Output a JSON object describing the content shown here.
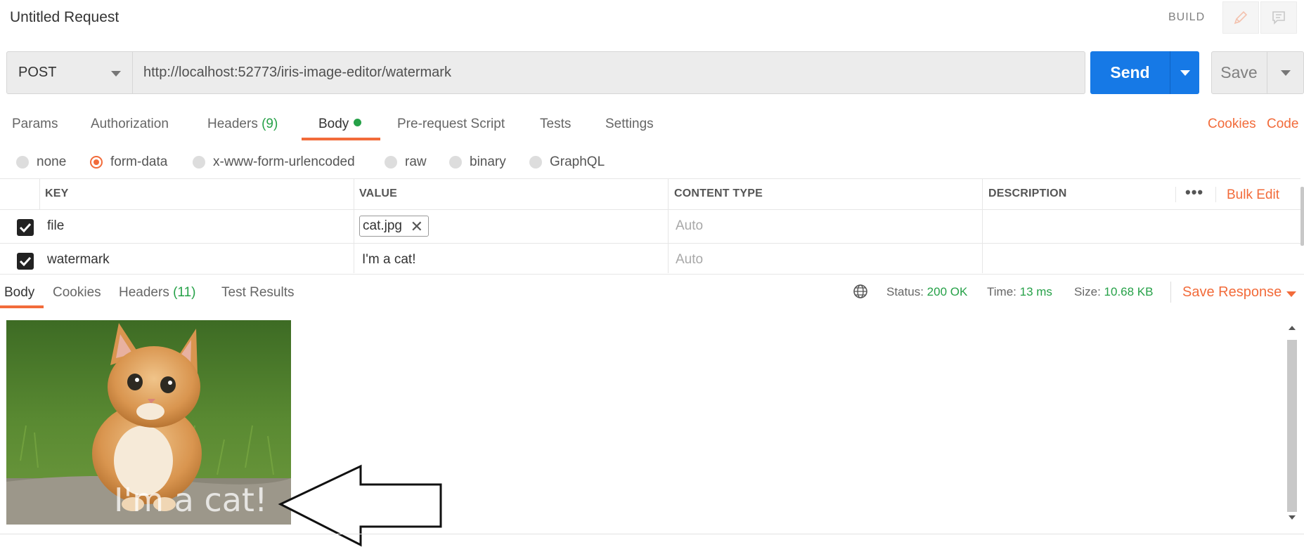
{
  "header": {
    "title": "Untitled Request",
    "build_label": "BUILD"
  },
  "request": {
    "method": "POST",
    "url": "http://localhost:52773/iris-image-editor/watermark",
    "send_label": "Send",
    "save_label": "Save"
  },
  "request_tabs": {
    "params": "Params",
    "authorization": "Authorization",
    "headers": "Headers",
    "headers_count": "(9)",
    "body": "Body",
    "pre_request": "Pre-request Script",
    "tests": "Tests",
    "settings": "Settings",
    "cookies_link": "Cookies",
    "code_link": "Code"
  },
  "body_types": [
    "none",
    "form-data",
    "x-www-form-urlencoded",
    "raw",
    "binary",
    "GraphQL"
  ],
  "form_table": {
    "columns": [
      "KEY",
      "VALUE",
      "CONTENT TYPE",
      "DESCRIPTION"
    ],
    "bulk_edit": "Bulk Edit",
    "more": "•••",
    "rows": [
      {
        "key": "file",
        "value": "cat.jpg",
        "content_type": "Auto",
        "description": ""
      },
      {
        "key": "watermark",
        "value": "I'm a cat!",
        "content_type": "Auto",
        "description": ""
      }
    ]
  },
  "response_tabs": {
    "body": "Body",
    "cookies": "Cookies",
    "headers": "Headers",
    "headers_count": "(11)",
    "test_results": "Test Results"
  },
  "response_meta": {
    "status_label": "Status:",
    "status_value": "200 OK",
    "time_label": "Time:",
    "time_value": "13 ms",
    "size_label": "Size:",
    "size_value": "10.68 KB",
    "save_response": "Save Response"
  },
  "response_image": {
    "watermark_text": "I'm a cat!"
  },
  "colors": {
    "accent": "#f26b3a",
    "send": "#1679e6",
    "success": "#26a148"
  }
}
